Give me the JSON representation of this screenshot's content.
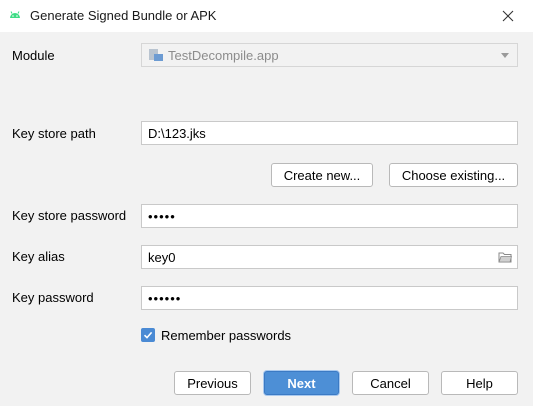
{
  "window": {
    "title": "Generate Signed Bundle or APK"
  },
  "module": {
    "label": "Module",
    "value": "TestDecompile.app"
  },
  "key_store_path": {
    "label": "Key store path",
    "value": "D:\\123.jks"
  },
  "key_store_buttons": {
    "create_new": "Create new...",
    "choose_existing": "Choose existing..."
  },
  "key_store_password": {
    "label": "Key store password",
    "value": "•••••"
  },
  "key_alias": {
    "label": "Key alias",
    "value": "key0"
  },
  "key_password": {
    "label": "Key password",
    "value": "••••••"
  },
  "remember": {
    "label": "Remember passwords",
    "checked": true
  },
  "footer": {
    "previous": "Previous",
    "next": "Next",
    "cancel": "Cancel",
    "help": "Help"
  },
  "colors": {
    "accent": "#4d8fd6",
    "android_green": "#3ddc84"
  },
  "icons": {
    "app": "android-icon",
    "close": "close-icon",
    "module": "module-icon",
    "folder": "folder-icon",
    "check": "check-icon"
  }
}
